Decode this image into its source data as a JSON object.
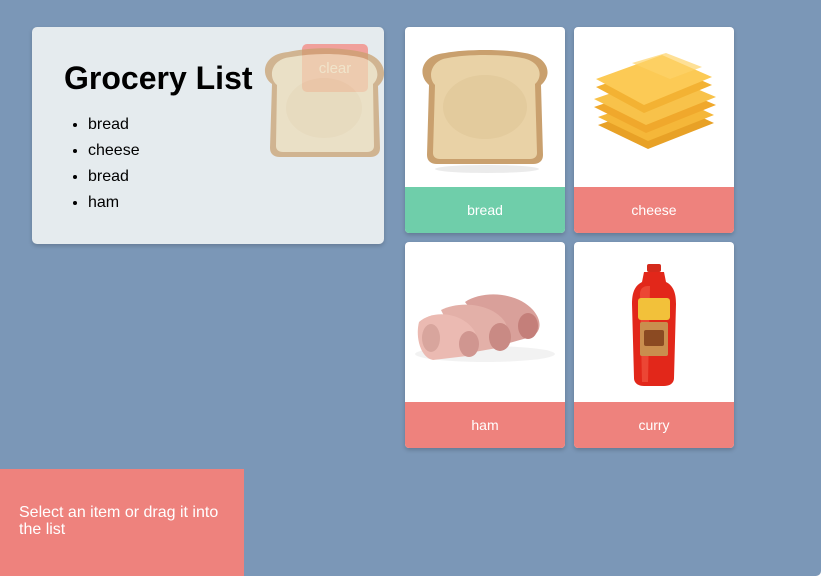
{
  "list": {
    "title": "Grocery List",
    "clear_label": "clear",
    "items": [
      "bread",
      "cheese",
      "bread",
      "ham"
    ]
  },
  "products": [
    {
      "name": "bread",
      "icon": "bread-slice-icon",
      "color": "#6fceaa"
    },
    {
      "name": "cheese",
      "icon": "cheese-slices-icon",
      "color": "#ee827d"
    },
    {
      "name": "ham",
      "icon": "ham-rolls-icon",
      "color": "#ee827d"
    },
    {
      "name": "curry",
      "icon": "curry-bottle-icon",
      "color": "#ee827d"
    }
  ],
  "hint": {
    "text": "Select an item or drag it into the list"
  },
  "colors": {
    "background": "#7b97b7",
    "panel": "#e5ebee",
    "selected": "#6fceaa",
    "unselected": "#ee827d",
    "button": "#f2938d"
  }
}
